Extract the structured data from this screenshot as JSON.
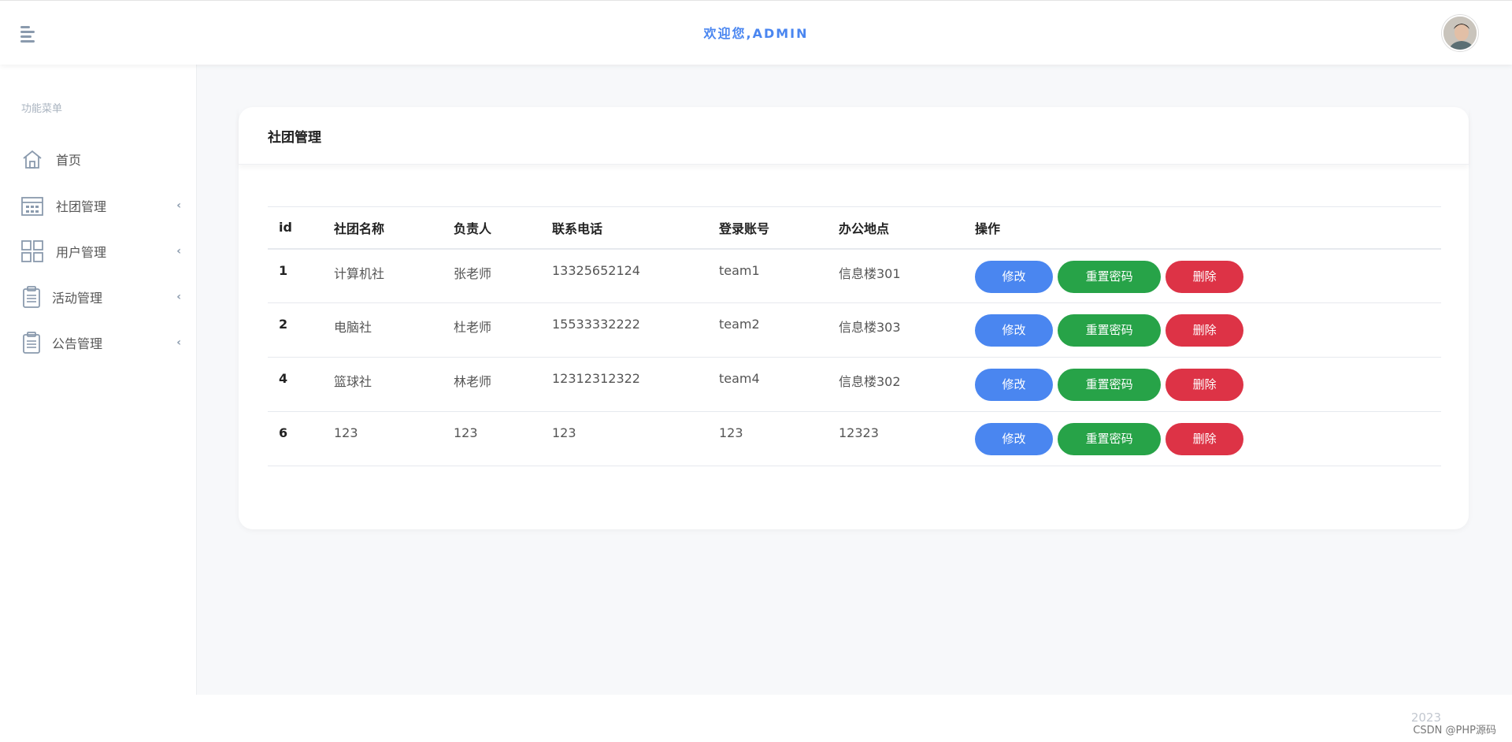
{
  "header": {
    "welcome": "欢迎您,ADMIN"
  },
  "sidebar": {
    "heading": "功能菜单",
    "items": [
      {
        "label": "首页",
        "icon": "home-icon",
        "has_submenu": false
      },
      {
        "label": "社团管理",
        "icon": "calendar-grid-icon",
        "has_submenu": true
      },
      {
        "label": "用户管理",
        "icon": "grid-icon",
        "has_submenu": true
      },
      {
        "label": "活动管理",
        "icon": "clipboard-icon",
        "has_submenu": true
      },
      {
        "label": "公告管理",
        "icon": "clipboard-icon",
        "has_submenu": true
      }
    ]
  },
  "card": {
    "title": "社团管理"
  },
  "table": {
    "columns": [
      "id",
      "社团名称",
      "负责人",
      "联系电话",
      "登录账号",
      "办公地点",
      "操作"
    ],
    "rows": [
      {
        "id": "1",
        "name": "计算机社",
        "leader": "张老师",
        "phone": "13325652124",
        "account": "team1",
        "location": "信息楼301"
      },
      {
        "id": "2",
        "name": "电脑社",
        "leader": "杜老师",
        "phone": "15533332222",
        "account": "team2",
        "location": "信息楼303"
      },
      {
        "id": "4",
        "name": "篮球社",
        "leader": "林老师",
        "phone": "12312312322",
        "account": "team4",
        "location": "信息楼302"
      },
      {
        "id": "6",
        "name": "123",
        "leader": "123",
        "phone": "123",
        "account": "123",
        "location": "12323"
      }
    ],
    "actions": {
      "edit": "修改",
      "reset": "重置密码",
      "delete": "删除"
    }
  },
  "footer": {
    "year": "2023",
    "watermark": "CSDN @PHP源码"
  },
  "colors": {
    "accent": "#4a86f0",
    "success": "#27a348",
    "danger": "#dd3346"
  }
}
